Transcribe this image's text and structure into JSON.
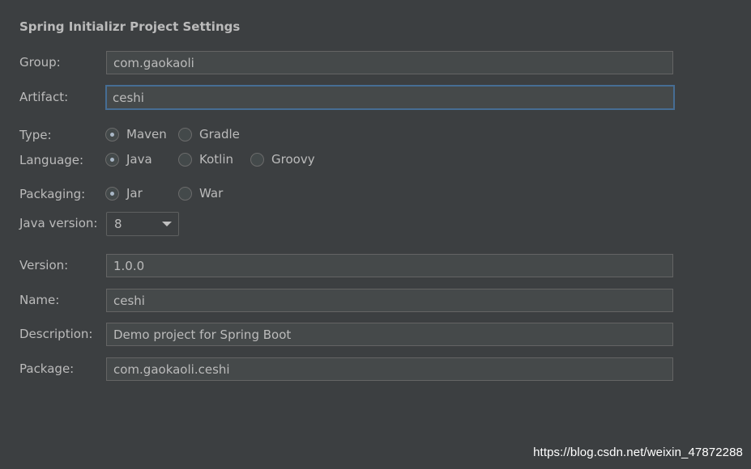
{
  "title": "Spring Initializr Project Settings",
  "fields": {
    "group": {
      "label": "Group:",
      "value": "com.gaokaoli"
    },
    "artifact": {
      "label": "Artifact:",
      "value": "ceshi"
    },
    "version": {
      "label": "Version:",
      "value": "1.0.0"
    },
    "name": {
      "label": "Name:",
      "value": "ceshi"
    },
    "description": {
      "label": "Description:",
      "value": "Demo project for Spring Boot"
    },
    "package": {
      "label": "Package:",
      "value": "com.gaokaoli.ceshi"
    }
  },
  "type": {
    "label": "Type:",
    "options": [
      "Maven",
      "Gradle"
    ],
    "selected": "Maven"
  },
  "language": {
    "label": "Language:",
    "options": [
      "Java",
      "Kotlin",
      "Groovy"
    ],
    "selected": "Java"
  },
  "packaging": {
    "label": "Packaging:",
    "options": [
      "Jar",
      "War"
    ],
    "selected": "Jar"
  },
  "java_version": {
    "label": "Java version:",
    "value": "8",
    "icon": "chevron-down-icon"
  },
  "watermark": "https://blog.csdn.net/weixin_47872288",
  "colors": {
    "background": "#3c3f41",
    "field_bg": "#45494a",
    "field_border": "#646464",
    "focus_border": "#466d94",
    "text": "#bbbbbb"
  }
}
